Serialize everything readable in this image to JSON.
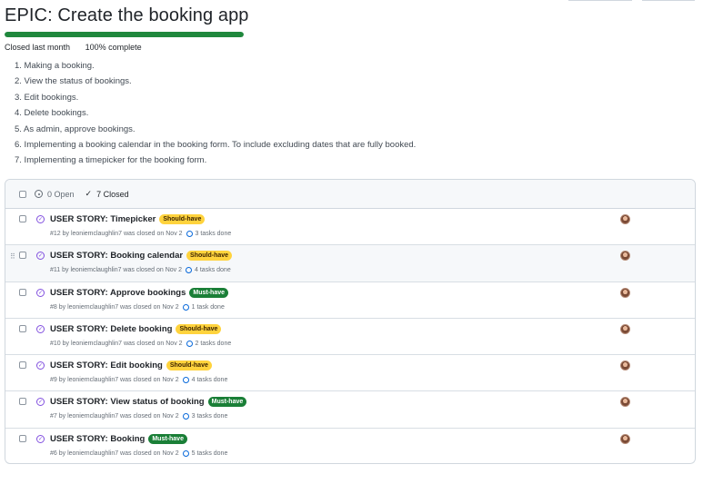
{
  "epic": {
    "title": "EPIC: Create the booking app",
    "progress_percent": 100,
    "closed_text": "Closed last month",
    "complete_text": "100% complete"
  },
  "description": [
    "1. Making a booking.",
    "2. View the status of bookings.",
    "3. Edit bookings.",
    "4. Delete bookings.",
    "5. As admin, approve bookings.",
    "6. Implementing a booking calendar in the booking form. To include excluding dates that are fully booked.",
    "7. Implementing a timepicker for the booking form."
  ],
  "header": {
    "open_label": "0 Open",
    "closed_label": "7 Closed"
  },
  "colors": {
    "should_have": "#ffd33d",
    "must_have": "#1a7f37",
    "closed_icon": "#8250df",
    "tasks_icon": "#0969da"
  },
  "issues": [
    {
      "title": "USER STORY: Timepicker",
      "label": "Should-have",
      "label_type": "should",
      "meta": "#12 by leoniemclaughlin7 was closed on Nov 2",
      "tasks": "3 tasks done"
    },
    {
      "title": "USER STORY: Booking calendar",
      "label": "Should-have",
      "label_type": "should",
      "meta": "#11 by leoniemclaughlin7 was closed on Nov 2",
      "tasks": "4 tasks done"
    },
    {
      "title": "USER STORY: Approve bookings",
      "label": "Must-have",
      "label_type": "must",
      "meta": "#8 by leoniemclaughlin7 was closed on Nov 2",
      "tasks": "1 task done"
    },
    {
      "title": "USER STORY: Delete booking",
      "label": "Should-have",
      "label_type": "should",
      "meta": "#10 by leoniemclaughlin7 was closed on Nov 2",
      "tasks": "2 tasks done"
    },
    {
      "title": "USER STORY: Edit booking",
      "label": "Should-have",
      "label_type": "should",
      "meta": "#9 by leoniemclaughlin7 was closed on Nov 2",
      "tasks": "4 tasks done"
    },
    {
      "title": "USER STORY: View status of booking",
      "label": "Must-have",
      "label_type": "must",
      "meta": "#7 by leoniemclaughlin7 was closed on Nov 2",
      "tasks": "3 tasks done"
    },
    {
      "title": "USER STORY: Booking",
      "label": "Must-have",
      "label_type": "must",
      "meta": "#6 by leoniemclaughlin7 was closed on Nov 2",
      "tasks": "5 tasks done"
    }
  ]
}
